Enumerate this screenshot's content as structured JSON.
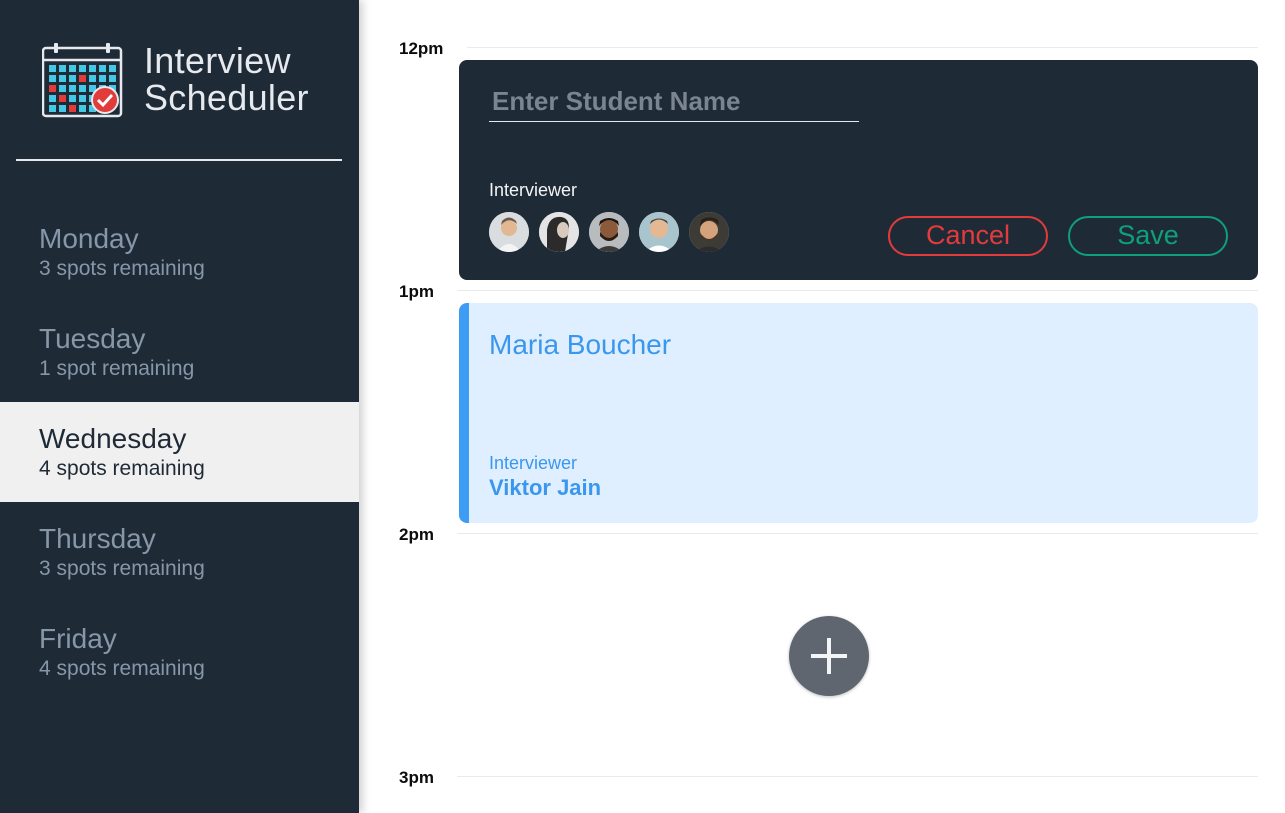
{
  "app": {
    "title_line1": "Interview",
    "title_line2": "Scheduler",
    "logo_icon": "calendar-check-icon"
  },
  "days": [
    {
      "name": "Monday",
      "spots": "3 spots remaining",
      "selected": false
    },
    {
      "name": "Tuesday",
      "spots": "1 spot remaining",
      "selected": false
    },
    {
      "name": "Wednesday",
      "spots": "4 spots remaining",
      "selected": true
    },
    {
      "name": "Thursday",
      "spots": "3 spots remaining",
      "selected": false
    },
    {
      "name": "Friday",
      "spots": "4 spots remaining",
      "selected": false
    }
  ],
  "times": [
    "12pm",
    "1pm",
    "2pm",
    "3pm"
  ],
  "form": {
    "placeholder": "Enter Student Name",
    "value": "",
    "interviewer_label": "Interviewer",
    "interviewer_avatars": [
      "avatar-1",
      "avatar-2",
      "avatar-3",
      "avatar-4",
      "avatar-5"
    ],
    "cancel_label": "Cancel",
    "save_label": "Save"
  },
  "appointment": {
    "student": "Maria Boucher",
    "interviewer_label": "Interviewer",
    "interviewer_name": "Viktor Jain"
  },
  "add": {
    "icon": "plus-icon"
  },
  "colors": {
    "sidebar": "#1f2a37",
    "selected_day_bg": "#f0f0f0",
    "accent_blue": "#3a97ee",
    "appointment_bg": "#e0efff",
    "cancel": "#e23b3b",
    "save": "#0f9f7a"
  }
}
